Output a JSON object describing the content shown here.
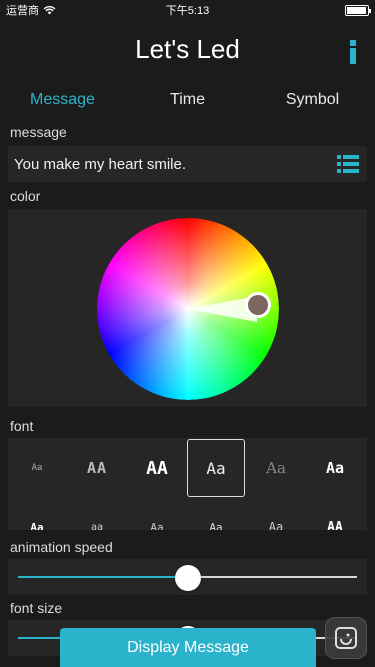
{
  "status_bar": {
    "carrier": "运营商",
    "time": "下午5:13",
    "battery_level": 0.95
  },
  "app": {
    "title": "Let's Led",
    "info_icon": "info-icon"
  },
  "tabs": [
    {
      "label": "Message",
      "active": true
    },
    {
      "label": "Time",
      "active": false
    },
    {
      "label": "Symbol",
      "active": false
    }
  ],
  "message_section": {
    "label": "message",
    "value": "You make my heart smile.",
    "list_icon": "list-icon"
  },
  "color_section": {
    "label": "color",
    "selected_color": "#7c6660"
  },
  "font_section": {
    "label": "font",
    "options": [
      {
        "sample": "Aa",
        "selected": false
      },
      {
        "sample": "AA",
        "selected": false
      },
      {
        "sample": "AA",
        "selected": false
      },
      {
        "sample": "Aa",
        "selected": true
      },
      {
        "sample": "Aa",
        "selected": false
      },
      {
        "sample": "Aa",
        "selected": false
      },
      {
        "sample": "Aa",
        "selected": false
      },
      {
        "sample": "aa",
        "selected": false
      },
      {
        "sample": "Aa",
        "selected": false
      },
      {
        "sample": "Aa",
        "selected": false
      },
      {
        "sample": "Aa",
        "selected": false
      },
      {
        "sample": "AA",
        "selected": false
      }
    ]
  },
  "animation_speed": {
    "label": "animation speed",
    "value": 0.5
  },
  "font_size": {
    "label": "font size",
    "value": 0.5
  },
  "display_button": {
    "label": "Display Message"
  },
  "colors": {
    "accent": "#2bb3cc",
    "background": "#1b1b1b",
    "panel": "#262626"
  }
}
